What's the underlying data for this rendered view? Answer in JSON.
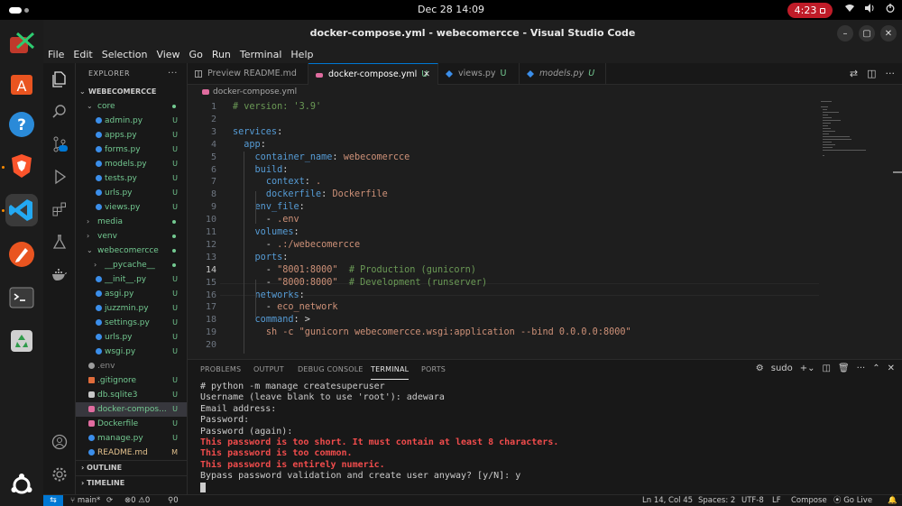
{
  "system": {
    "clock": "Dec 28  14:09",
    "recording_time": "4:23"
  },
  "window": {
    "title": "docker-compose.yml - webecomercce - Visual Studio Code"
  },
  "menu": [
    "File",
    "Edit",
    "Selection",
    "View",
    "Go",
    "Run",
    "Terminal",
    "Help"
  ],
  "explorer": {
    "header": "EXPLORER",
    "root": "WEBECOMERCCE",
    "items": [
      {
        "label": "core",
        "kind": "folder-open",
        "indent": 1,
        "badge": "dot",
        "color": "green"
      },
      {
        "label": "admin.py",
        "kind": "py",
        "indent": 2,
        "badge": "U",
        "color": "green"
      },
      {
        "label": "apps.py",
        "kind": "py",
        "indent": 2,
        "badge": "U",
        "color": "green"
      },
      {
        "label": "forms.py",
        "kind": "py",
        "indent": 2,
        "badge": "U",
        "color": "green"
      },
      {
        "label": "models.py",
        "kind": "py",
        "indent": 2,
        "badge": "U",
        "color": "green"
      },
      {
        "label": "tests.py",
        "kind": "py",
        "indent": 2,
        "badge": "U",
        "color": "green"
      },
      {
        "label": "urls.py",
        "kind": "py",
        "indent": 2,
        "badge": "U",
        "color": "green"
      },
      {
        "label": "views.py",
        "kind": "py",
        "indent": 2,
        "badge": "U",
        "color": "green"
      },
      {
        "label": "media",
        "kind": "folder",
        "indent": 1,
        "badge": "dot",
        "color": "green"
      },
      {
        "label": "venv",
        "kind": "folder",
        "indent": 1,
        "badge": "dot",
        "color": "green"
      },
      {
        "label": "webecomercce",
        "kind": "folder-open",
        "indent": 1,
        "badge": "dot",
        "color": "green"
      },
      {
        "label": "__pycache__",
        "kind": "folder",
        "indent": 2,
        "badge": "dot",
        "color": "green"
      },
      {
        "label": "__init__.py",
        "kind": "py",
        "indent": 2,
        "badge": "U",
        "color": "green"
      },
      {
        "label": "asgi.py",
        "kind": "py",
        "indent": 2,
        "badge": "U",
        "color": "green"
      },
      {
        "label": "juzzmin.py",
        "kind": "py",
        "indent": 2,
        "badge": "U",
        "color": "green"
      },
      {
        "label": "settings.py",
        "kind": "py",
        "indent": 2,
        "badge": "U",
        "color": "green"
      },
      {
        "label": "urls.py",
        "kind": "py",
        "indent": 2,
        "badge": "U",
        "color": "green"
      },
      {
        "label": "wsgi.py",
        "kind": "py",
        "indent": 2,
        "badge": "U",
        "color": "green"
      },
      {
        "label": ".env",
        "kind": "gear",
        "indent": 1,
        "badge": "",
        "color": "gray"
      },
      {
        "label": ".gitignore",
        "kind": "git",
        "indent": 1,
        "badge": "U",
        "color": "green"
      },
      {
        "label": "db.sqlite3",
        "kind": "db",
        "indent": 1,
        "badge": "U",
        "color": "green"
      },
      {
        "label": "docker-compos...",
        "kind": "docker",
        "indent": 1,
        "badge": "U",
        "color": "green",
        "selected": true
      },
      {
        "label": "Dockerfile",
        "kind": "docker",
        "indent": 1,
        "badge": "U",
        "color": "green"
      },
      {
        "label": "manage.py",
        "kind": "py",
        "indent": 1,
        "badge": "U",
        "color": "green"
      },
      {
        "label": "README.md",
        "kind": "info",
        "indent": 1,
        "badge": "M",
        "color": "mod"
      }
    ],
    "sections": [
      "OUTLINE",
      "TIMELINE"
    ]
  },
  "tabs": [
    {
      "label": "Preview README.md",
      "icon": "preview",
      "status": ""
    },
    {
      "label": "docker-compose.yml",
      "icon": "docker",
      "status": "U",
      "active": true
    },
    {
      "label": "views.py",
      "icon": "py",
      "status": "U"
    },
    {
      "label": "models.py",
      "icon": "py",
      "status": "U",
      "italic": true
    }
  ],
  "breadcrumb": "docker-compose.yml",
  "code": [
    [
      [
        "c-com",
        "# version: '3.9'"
      ]
    ],
    [],
    [
      [
        "c-key",
        "services"
      ],
      [
        "c-plain",
        ":"
      ]
    ],
    [
      [
        "c-plain",
        "  "
      ],
      [
        "c-key",
        "app"
      ],
      [
        "c-plain",
        ":"
      ]
    ],
    [
      [
        "c-plain",
        "    "
      ],
      [
        "c-key",
        "container_name"
      ],
      [
        "c-plain",
        ": "
      ],
      [
        "c-str",
        "webecomercce"
      ]
    ],
    [
      [
        "c-plain",
        "    "
      ],
      [
        "c-key",
        "build"
      ],
      [
        "c-plain",
        ":"
      ]
    ],
    [
      [
        "c-plain",
        "      "
      ],
      [
        "c-key",
        "context"
      ],
      [
        "c-plain",
        ": "
      ],
      [
        "c-str",
        "."
      ]
    ],
    [
      [
        "c-plain",
        "      "
      ],
      [
        "c-key",
        "dockerfile"
      ],
      [
        "c-plain",
        ": "
      ],
      [
        "c-str",
        "Dockerfile"
      ]
    ],
    [
      [
        "c-plain",
        "    "
      ],
      [
        "c-key",
        "env_file"
      ],
      [
        "c-plain",
        ":"
      ]
    ],
    [
      [
        "c-plain",
        "      - "
      ],
      [
        "c-str",
        ".env"
      ]
    ],
    [
      [
        "c-plain",
        "    "
      ],
      [
        "c-key",
        "volumes"
      ],
      [
        "c-plain",
        ":"
      ]
    ],
    [
      [
        "c-plain",
        "      - "
      ],
      [
        "c-str",
        ".:/webecomercce"
      ]
    ],
    [
      [
        "c-plain",
        "    "
      ],
      [
        "c-key",
        "ports"
      ],
      [
        "c-plain",
        ":"
      ]
    ],
    [
      [
        "c-plain",
        "      - "
      ],
      [
        "c-str",
        "\"8001:8000\""
      ],
      [
        "c-plain",
        "  "
      ],
      [
        "c-com",
        "# Production (gunicorn)"
      ]
    ],
    [
      [
        "c-plain",
        "      - "
      ],
      [
        "c-str",
        "\"8000:8000\""
      ],
      [
        "c-plain",
        "  "
      ],
      [
        "c-com",
        "# Development (runserver)"
      ]
    ],
    [
      [
        "c-plain",
        "    "
      ],
      [
        "c-key",
        "networks"
      ],
      [
        "c-plain",
        ":"
      ]
    ],
    [
      [
        "c-plain",
        "      - "
      ],
      [
        "c-str",
        "eco_network"
      ]
    ],
    [
      [
        "c-plain",
        "    "
      ],
      [
        "c-key",
        "command"
      ],
      [
        "c-plain",
        ": >"
      ]
    ],
    [
      [
        "c-plain",
        "      "
      ],
      [
        "c-str",
        "sh -c \"gunicorn webecomercce.wsgi:application --bind 0.0.0.0:8000\""
      ]
    ],
    [],
    [
      [
        "c-plain",
        " "
      ]
    ]
  ],
  "current_line": 14,
  "panel": {
    "tabs": [
      "PROBLEMS",
      "OUTPUT",
      "DEBUG CONSOLE",
      "TERMINAL",
      "PORTS"
    ],
    "active_tab": "TERMINAL",
    "terminal_name": "sudo"
  },
  "terminal": [
    {
      "text": "# python -m manage createsuperuser",
      "err": false
    },
    {
      "text": "Username (leave blank to use 'root'): adewara",
      "err": false
    },
    {
      "text": "Email address:",
      "err": false
    },
    {
      "text": "Password:",
      "err": false
    },
    {
      "text": "Password (again):",
      "err": false
    },
    {
      "text": "This password is too short. It must contain at least 8 characters.",
      "err": true
    },
    {
      "text": "This password is too common.",
      "err": true
    },
    {
      "text": "This password is entirely numeric.",
      "err": true
    },
    {
      "text": "Bypass password validation and create user anyway? [y/N]: y",
      "err": false
    }
  ],
  "status": {
    "branch": "main*",
    "errors": "0",
    "warnings": "0",
    "ports": "0",
    "position": "Ln 14, Col 45",
    "spaces": "Spaces: 2",
    "encoding": "UTF-8",
    "eol": "LF",
    "language": "Compose",
    "golive": "Go Live"
  },
  "colors": {
    "accent": "#0078d4",
    "untracked": "#73c991",
    "modified": "#e2c08d",
    "error_text": "#f14c4c",
    "recording": "#c01c28"
  }
}
